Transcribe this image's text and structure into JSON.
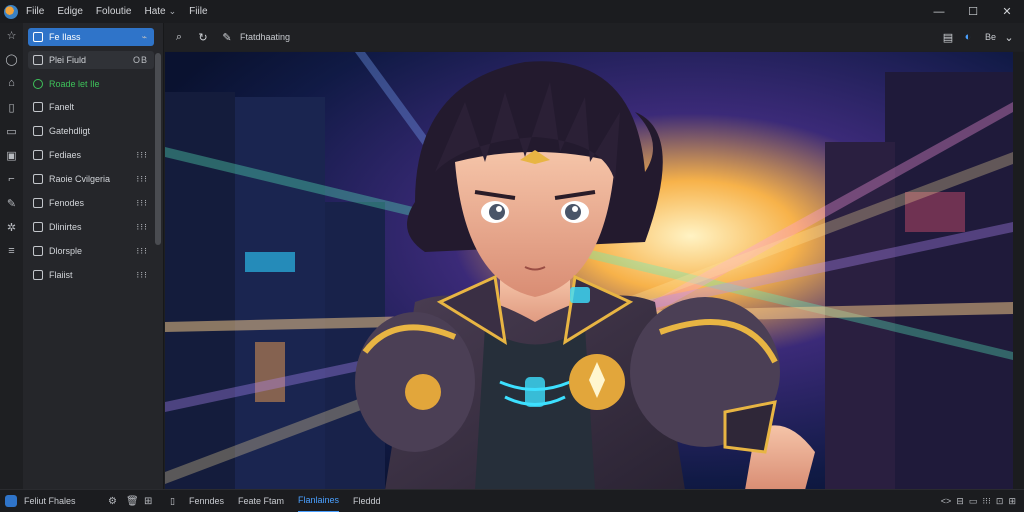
{
  "menu": {
    "items": [
      "Fiile",
      "Edige",
      "Foloutie",
      "Hate",
      "Fiile"
    ],
    "caret": "⌄"
  },
  "window": {
    "minimize": "—",
    "maximize": "☐",
    "close": "✕"
  },
  "sidebar": {
    "items": [
      {
        "label": "Fe Ilass",
        "right": "⌁",
        "state": "active"
      },
      {
        "label": "Plei Fiuld",
        "right": "OB",
        "state": "hover"
      },
      {
        "label": "Roade let Ile",
        "right": "",
        "state": "green"
      },
      {
        "label": "Fanelt",
        "right": "",
        "state": "normal"
      },
      {
        "label": "Gatehdligt",
        "right": "",
        "state": "normal"
      },
      {
        "label": "Fediaes",
        "right": "⁝⁝⁝",
        "state": "normal"
      },
      {
        "label": "Raoie Cvilgeria",
        "right": "⁝⁝⁝",
        "state": "normal"
      },
      {
        "label": "Fenodes",
        "right": "⁝⁝⁝",
        "state": "normal"
      },
      {
        "label": "Dlinirtes",
        "right": "⁝⁝⁝",
        "state": "normal"
      },
      {
        "label": "Dlorsple",
        "right": "⁝⁝⁝",
        "state": "normal"
      },
      {
        "label": "Flaiist",
        "right": "⁝⁝⁝",
        "state": "normal"
      }
    ]
  },
  "toolbar": {
    "label": "Ftatdhaating",
    "right_text": "Be"
  },
  "statusbar": {
    "user": "Feliut Fhales",
    "tabs": [
      {
        "label": "Fenndes",
        "active": false
      },
      {
        "label": "Feate Ftam",
        "active": false
      },
      {
        "label": "Flanlaines",
        "active": true
      },
      {
        "label": "Fleddd",
        "active": false
      }
    ],
    "right": [
      "<>",
      "⊟",
      "▭",
      "⁝⁝⁝",
      "⊡",
      "⊞"
    ]
  },
  "colors": {
    "accent": "#2f74c9",
    "link": "#4aa0ff",
    "green": "#3ec25a",
    "titlebar": "#1b1c1f",
    "sidebar": "#25262a"
  }
}
